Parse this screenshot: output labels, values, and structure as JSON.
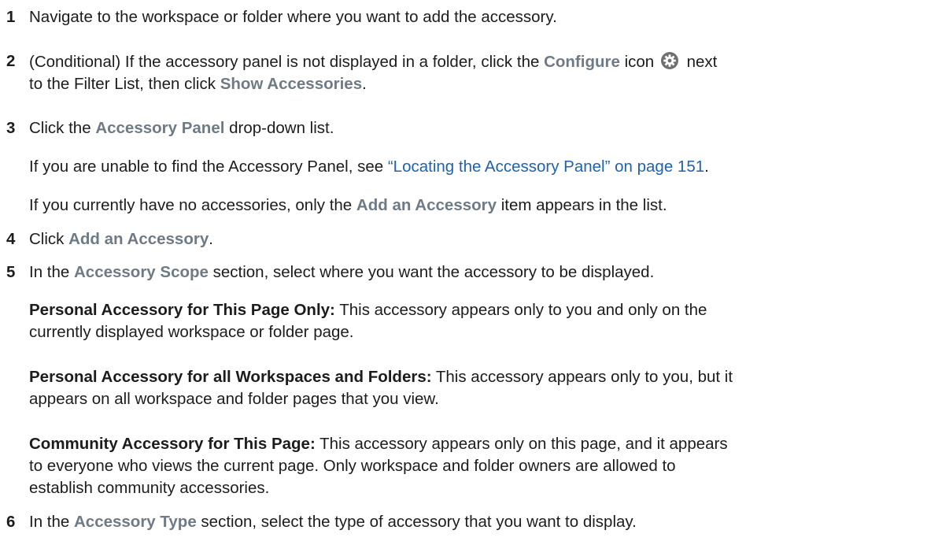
{
  "steps": [
    {
      "num": "1",
      "text": "Navigate to the workspace or folder where you want to add the accessory."
    },
    {
      "num": "2",
      "pre": "(Conditional) If the accessory panel is not displayed in a folder, click the ",
      "ui1": "Configure",
      "mid1": " icon",
      "post1": " next",
      "line2_pre": "to the Filter List, then click ",
      "ui2": "Show Accessories",
      "end": "."
    },
    {
      "num": "3",
      "pre": "Click the ",
      "ui": "Accessory Panel",
      "post": " drop-down list."
    },
    {
      "num": "4",
      "pre": "Click ",
      "ui": "Add an Accessory",
      "post": "."
    },
    {
      "num": "5",
      "pre": "In the ",
      "ui": "Accessory Scope",
      "post": " section, select where you want the accessory to be displayed."
    },
    {
      "num": "6",
      "pre": "In the ",
      "ui": "Accessory Type",
      "post": " section, select the type of accessory that you want to display."
    }
  ],
  "step3_notes": {
    "note1_pre": "If you are unable to find the Accessory Panel, see ",
    "note1_link": "“Locating the Accessory Panel” on page 151",
    "note1_post": ".",
    "note2_pre": "If you currently have no accessories, only the ",
    "note2_ui": "Add an Accessory",
    "note2_post": " item appears in the list."
  },
  "scope_options": [
    {
      "term": "Personal Accessory for This Page Only:",
      "line1": " This accessory appears only to you and only on the",
      "line2": "currently displayed workspace or folder page."
    },
    {
      "term": "Personal Accessory for all Workspaces and Folders:",
      "line1": " This accessory appears only to you, but it",
      "line2": "appears on all workspace and folder pages that you view."
    },
    {
      "term": "Community Accessory for This Page:",
      "line1": " This accessory appears only on this page, and it appears",
      "line2": "to everyone who views the current page. Only workspace and folder owners are allowed to",
      "line3": "establish community accessories."
    }
  ],
  "icons": {
    "configure": "gear-icon"
  },
  "colors": {
    "ui_label": "#6e7b86",
    "link": "#1f62ae",
    "text": "#1c1c1c"
  }
}
